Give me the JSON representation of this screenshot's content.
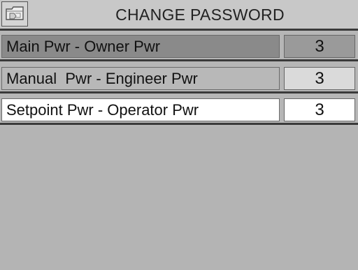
{
  "header": {
    "title": "CHANGE PASSWORD",
    "back_icon": "folder-back-icon"
  },
  "rows": [
    {
      "label": "Main Pwr - Owner Pwr",
      "value": "3",
      "state": "selected"
    },
    {
      "label": "Manual  Pwr - Engineer Pwr",
      "value": "3",
      "state": "normal"
    },
    {
      "label": "Setpoint Pwr - Operator Pwr",
      "value": "3",
      "state": "editing"
    }
  ],
  "colors": {
    "background": "#b6b6b6",
    "selected_row": "#8a8a8a",
    "editing_row": "#ffffff",
    "divider": "#3a3a3a"
  }
}
